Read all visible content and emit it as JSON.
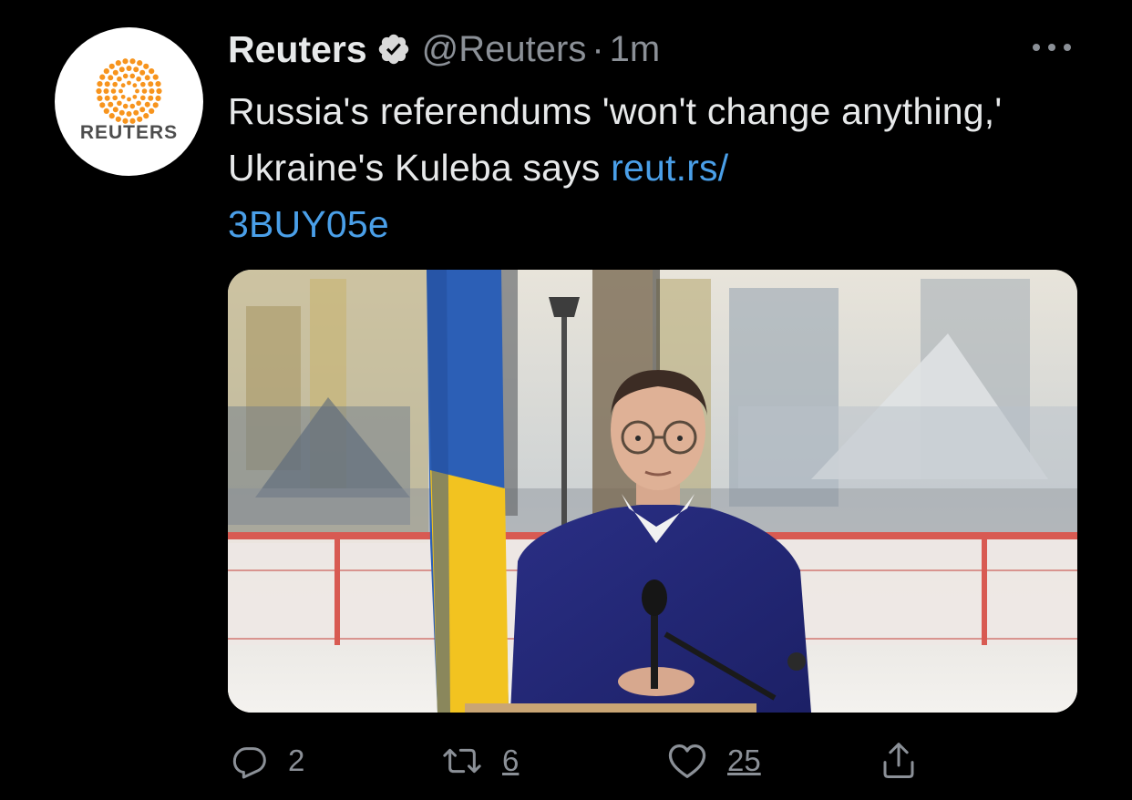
{
  "tweet": {
    "author_name": "Reuters",
    "handle": "@Reuters",
    "separator": "·",
    "time": "1m",
    "verified": true,
    "avatar_text": "REUTERS",
    "text": "Russia's referendums 'won't change anything,' Ukraine's Kuleba says",
    "link_line1": "reut.rs/",
    "link_line2": "3BUY05e",
    "media_icon": "photo",
    "actions": {
      "replies": "2",
      "retweets": "6",
      "likes": "25"
    },
    "icons": {
      "reply": "reply-bubble-icon",
      "retweet": "retweet-arrows-icon",
      "like": "heart-icon",
      "share": "share-upload-icon",
      "more": "more-dots-icon",
      "verified": "verified-badge-icon"
    },
    "colors": {
      "background": "#000000",
      "text": "#e7e9ea",
      "secondary": "#8b9097",
      "link": "#4a9fe8",
      "reuters_orange": "#f7941d"
    }
  }
}
